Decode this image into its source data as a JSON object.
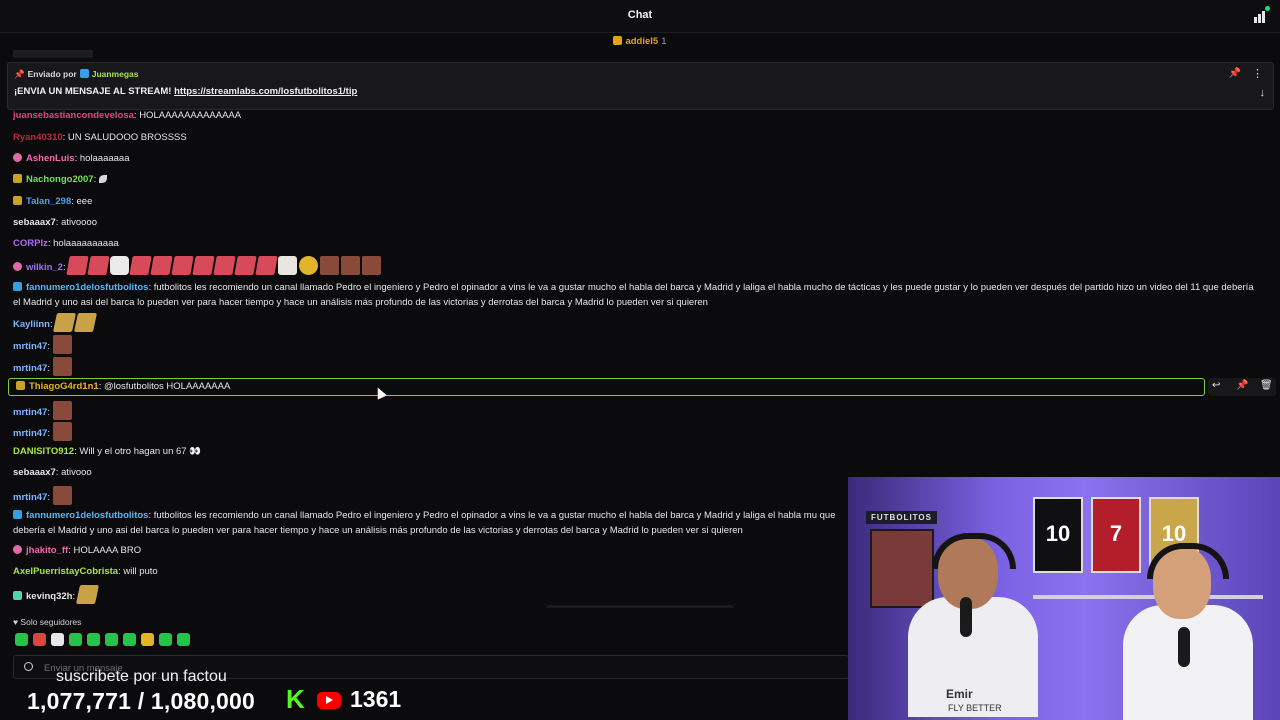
{
  "header": {
    "title": "Chat"
  },
  "gift_row": {
    "user": "addiel5",
    "count": "1"
  },
  "pinned": {
    "sent_by_label": "Enviado por",
    "sender": "Juanmegas",
    "message": "¡ENVIA UN MENSAJE AL STREAM!",
    "link": "https://streamlabs.com/losfutbolitos1/tip"
  },
  "messages": [
    {
      "user": "juansebastiancondevelosa",
      "color": "#e0457b",
      "text": ": HOLAAAAAAAAAAAAA"
    },
    {
      "user": "Ryan40310",
      "color": "#c0283a",
      "text": ": UN SALUDOOO BROSSSS"
    },
    {
      "user": "AshenLuis",
      "color": "#ef6ab0",
      "text": ": holaaaaaaa"
    },
    {
      "user": "Nachongo2007",
      "color": "#6fe34a",
      "text": ":"
    },
    {
      "user": "Talan_298",
      "color": "#4f9fe8",
      "text": ": eee"
    },
    {
      "user": "sebaaax7",
      "color": "#e6e6e6",
      "text": ": ativoooo"
    },
    {
      "user": "CORPIz",
      "color": "#b06bf0",
      "text": ": holaaaaaaaaaa"
    },
    {
      "user": "wilkin_2",
      "color": "#a070f0",
      "text": ":"
    },
    {
      "user": "fannumero1delosfutbolitos",
      "color": "#4fb8ff",
      "text": ": futbolitos les recomiendo un canal llamado Pedro el ingeniero y Pedro el opinador a vins le va a gustar mucho el habla del barca y Madrid y laliga el habla mucho de tácticas y les puede gustar y lo pueden ver después del partido hizo un video del 11 que debería el Madrid y uno asi del barca lo pueden ver para hacer tiempo y hace un análisis más profundo de las victorias y derrotas del barca y Madrid lo pueden ver si quieren"
    },
    {
      "user": "Kayliinn",
      "color": "#7fb6ff",
      "text": ":"
    },
    {
      "user": "mrtin47",
      "color": "#7fb6ff",
      "text": ":"
    },
    {
      "user": "mrtin47",
      "color": "#7fb6ff",
      "text": ":"
    },
    {
      "user": "ThiagoG4rd1n1",
      "color": "#e3b32a",
      "text": ": @losfutbolitos HOLAAAAAAA"
    },
    {
      "user": "mrtin47",
      "color": "#7fb6ff",
      "text": ":"
    },
    {
      "user": "mrtin47",
      "color": "#7fb6ff",
      "text": ":"
    },
    {
      "user": "DANISITO912",
      "color": "#a9e34b",
      "text": ": Will y el otro hagan un 67 👀"
    },
    {
      "user": "sebaaax7",
      "color": "#e6e6e6",
      "text": ": ativooo"
    },
    {
      "user": "mrtin47",
      "color": "#7fb6ff",
      "text": ":"
    },
    {
      "user": "fannumero1delosfutbolitos",
      "color": "#4fb8ff",
      "text": ": futbolitos les recomiendo un canal llamado Pedro el ingeniero y Pedro el opinador a vins le va a gustar mucho el habla del barca y Madrid y laliga el habla mu que debería el Madrid y uno asi del barca lo pueden ver para hacer tiempo y hace un análisis más profundo de las victorias y derrotas del barca y Madrid lo pueden ver si quieren"
    },
    {
      "user": "jhakito_ff",
      "color": "#ef6ab0",
      "text": ": HOLAAAA BRO"
    },
    {
      "user": "AxelPuerristayCobrista",
      "color": "#a9e34b",
      "text": ": will puto"
    },
    {
      "user": "kevinq32h",
      "color": "#e6e6e6",
      "text": ":"
    }
  ],
  "followers_only": "Solo seguidores",
  "input": {
    "placeholder": "Enviar un mensaje"
  },
  "overlay": {
    "caption": "suscribete por un factou",
    "subcount": "1,077,771  / 1,080,000",
    "kick_logo": "K",
    "viewers": "1361"
  },
  "webcam": {
    "sign": "FUTBOLITOS",
    "jersey_numbers": [
      "10",
      "7",
      "10"
    ],
    "shirt_text": "Emir",
    "shirt_subtext": "FLY BETTER"
  },
  "colors": {
    "background": "#0b0b0d",
    "pinned_bg": "#18181b",
    "highlight_border": "#7fcf3a",
    "kick": "#53fc18",
    "youtube": "#ff0000"
  },
  "icons": [
    "users-icon",
    "pin-icon",
    "more-icon",
    "arrow-down-icon",
    "reply-icon",
    "trash-icon",
    "heart-icon",
    "emoji-icon"
  ]
}
